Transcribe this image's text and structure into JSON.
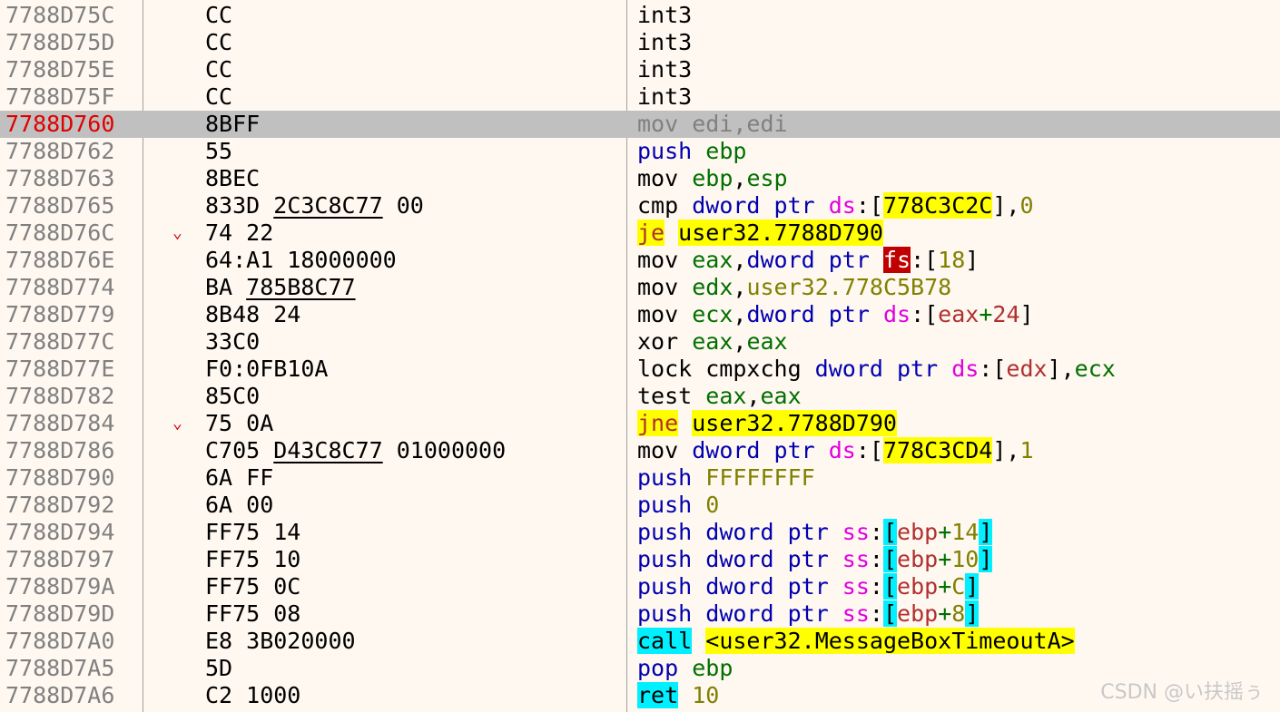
{
  "rows": [
    {
      "addr": "7788D75C",
      "arrow": "",
      "bytes": [
        {
          "t": "CC"
        }
      ],
      "dis": [
        {
          "t": "int3"
        }
      ]
    },
    {
      "addr": "7788D75D",
      "arrow": "",
      "bytes": [
        {
          "t": "CC"
        }
      ],
      "dis": [
        {
          "t": "int3"
        }
      ]
    },
    {
      "addr": "7788D75E",
      "arrow": "",
      "bytes": [
        {
          "t": "CC"
        }
      ],
      "dis": [
        {
          "t": "int3"
        }
      ]
    },
    {
      "addr": "7788D75F",
      "arrow": "",
      "bytes": [
        {
          "t": "CC"
        }
      ],
      "dis": [
        {
          "t": "int3"
        }
      ]
    },
    {
      "addr": "7788D760",
      "eip": true,
      "selected": true,
      "arrow": "",
      "bytes": [
        {
          "t": "8BFF"
        }
      ],
      "dis": [
        {
          "t": "mov edi,edi"
        }
      ]
    },
    {
      "addr": "7788D762",
      "arrow": "",
      "bytes": [
        {
          "t": "55"
        }
      ],
      "dis": [
        {
          "t": "push",
          "c": "ins"
        },
        {
          "t": " "
        },
        {
          "t": "ebp",
          "c": "reg"
        }
      ]
    },
    {
      "addr": "7788D763",
      "arrow": "",
      "bytes": [
        {
          "t": "8BEC"
        }
      ],
      "dis": [
        {
          "t": "mov "
        },
        {
          "t": "ebp",
          "c": "reg"
        },
        {
          "t": ","
        },
        {
          "t": "esp",
          "c": "reg"
        }
      ]
    },
    {
      "addr": "7788D765",
      "arrow": "",
      "bytes": [
        {
          "t": "833D "
        },
        {
          "t": "2C3C8C77",
          "u": true
        },
        {
          "t": " 00"
        }
      ],
      "dis": [
        {
          "t": "cmp "
        },
        {
          "t": "dword ptr ",
          "c": "ins"
        },
        {
          "t": "ds",
          "c": "seg"
        },
        {
          "t": ":["
        },
        {
          "t": "778C3C2C",
          "h": "y"
        },
        {
          "t": "],"
        },
        {
          "t": "0",
          "c": "num"
        }
      ]
    },
    {
      "addr": "7788D76C",
      "arrow": "⌄",
      "bytes": [
        {
          "t": "74 22"
        }
      ],
      "dis": [
        {
          "t": "je",
          "c": "mem",
          "h": "y"
        },
        {
          "t": " "
        },
        {
          "t": "user32.7788D790",
          "h": "y"
        }
      ]
    },
    {
      "addr": "7788D76E",
      "arrow": "",
      "bytes": [
        {
          "t": "64:A1 18000000"
        }
      ],
      "dis": [
        {
          "t": "mov "
        },
        {
          "t": "eax",
          "c": "reg"
        },
        {
          "t": ","
        },
        {
          "t": "dword ptr ",
          "c": "ins"
        },
        {
          "t": "fs",
          "h": "r"
        },
        {
          "t": ":["
        },
        {
          "t": "18",
          "c": "num"
        },
        {
          "t": "]"
        }
      ]
    },
    {
      "addr": "7788D774",
      "arrow": "",
      "bytes": [
        {
          "t": "BA "
        },
        {
          "t": "785B8C77",
          "u": true
        }
      ],
      "dis": [
        {
          "t": "mov "
        },
        {
          "t": "edx",
          "c": "reg"
        },
        {
          "t": ","
        },
        {
          "t": "user32.778C5B78",
          "c": "num"
        }
      ]
    },
    {
      "addr": "7788D779",
      "arrow": "",
      "bytes": [
        {
          "t": "8B48 24"
        }
      ],
      "dis": [
        {
          "t": "mov "
        },
        {
          "t": "ecx",
          "c": "reg"
        },
        {
          "t": ","
        },
        {
          "t": "dword ptr ",
          "c": "ins"
        },
        {
          "t": "ds",
          "c": "seg"
        },
        {
          "t": ":["
        },
        {
          "t": "eax",
          "c": "mem"
        },
        {
          "t": "+",
          "c": "reg"
        },
        {
          "t": "24",
          "c": "mem"
        },
        {
          "t": "]"
        }
      ]
    },
    {
      "addr": "7788D77C",
      "arrow": "",
      "bytes": [
        {
          "t": "33C0"
        }
      ],
      "dis": [
        {
          "t": "xor "
        },
        {
          "t": "eax",
          "c": "reg"
        },
        {
          "t": ","
        },
        {
          "t": "eax",
          "c": "reg"
        }
      ]
    },
    {
      "addr": "7788D77E",
      "arrow": "",
      "bytes": [
        {
          "t": "F0:0FB10A"
        }
      ],
      "dis": [
        {
          "t": "lock cmpxchg "
        },
        {
          "t": "dword ptr ",
          "c": "ins"
        },
        {
          "t": "ds",
          "c": "seg"
        },
        {
          "t": ":["
        },
        {
          "t": "edx",
          "c": "mem"
        },
        {
          "t": "],"
        },
        {
          "t": "ecx",
          "c": "reg"
        }
      ]
    },
    {
      "addr": "7788D782",
      "arrow": "",
      "bytes": [
        {
          "t": "85C0"
        }
      ],
      "dis": [
        {
          "t": "test "
        },
        {
          "t": "eax",
          "c": "reg"
        },
        {
          "t": ","
        },
        {
          "t": "eax",
          "c": "reg"
        }
      ]
    },
    {
      "addr": "7788D784",
      "arrow": "⌄",
      "bytes": [
        {
          "t": "75 0A"
        }
      ],
      "dis": [
        {
          "t": "jne",
          "c": "mem",
          "h": "y"
        },
        {
          "t": " "
        },
        {
          "t": "user32.7788D790",
          "h": "y"
        }
      ]
    },
    {
      "addr": "7788D786",
      "arrow": "",
      "bytes": [
        {
          "t": "C705 "
        },
        {
          "t": "D43C8C77",
          "u": true
        },
        {
          "t": " 01000000"
        }
      ],
      "dis": [
        {
          "t": "mov "
        },
        {
          "t": "dword ptr ",
          "c": "ins"
        },
        {
          "t": "ds",
          "c": "seg"
        },
        {
          "t": ":["
        },
        {
          "t": "778C3CD4",
          "h": "y"
        },
        {
          "t": "],"
        },
        {
          "t": "1",
          "c": "num"
        }
      ]
    },
    {
      "addr": "7788D790",
      "arrow": "",
      "bytes": [
        {
          "t": "6A FF"
        }
      ],
      "dis": [
        {
          "t": "push",
          "c": "ins"
        },
        {
          "t": " "
        },
        {
          "t": "FFFFFFFF",
          "c": "num"
        }
      ]
    },
    {
      "addr": "7788D792",
      "arrow": "",
      "bytes": [
        {
          "t": "6A 00"
        }
      ],
      "dis": [
        {
          "t": "push",
          "c": "ins"
        },
        {
          "t": " "
        },
        {
          "t": "0",
          "c": "num"
        }
      ]
    },
    {
      "addr": "7788D794",
      "arrow": "",
      "bytes": [
        {
          "t": "FF75 14"
        }
      ],
      "dis": [
        {
          "t": "push",
          "c": "ins"
        },
        {
          "t": " "
        },
        {
          "t": "dword ptr ",
          "c": "ins"
        },
        {
          "t": "ss",
          "c": "seg"
        },
        {
          "t": ":"
        },
        {
          "t": "[",
          "h": "c"
        },
        {
          "t": "ebp",
          "c": "mem"
        },
        {
          "t": "+",
          "c": "reg"
        },
        {
          "t": "14",
          "c": "num"
        },
        {
          "t": "]",
          "h": "c"
        }
      ]
    },
    {
      "addr": "7788D797",
      "arrow": "",
      "bytes": [
        {
          "t": "FF75 10"
        }
      ],
      "dis": [
        {
          "t": "push",
          "c": "ins"
        },
        {
          "t": " "
        },
        {
          "t": "dword ptr ",
          "c": "ins"
        },
        {
          "t": "ss",
          "c": "seg"
        },
        {
          "t": ":"
        },
        {
          "t": "[",
          "h": "c"
        },
        {
          "t": "ebp",
          "c": "mem"
        },
        {
          "t": "+",
          "c": "reg"
        },
        {
          "t": "10",
          "c": "num"
        },
        {
          "t": "]",
          "h": "c"
        }
      ]
    },
    {
      "addr": "7788D79A",
      "arrow": "",
      "bytes": [
        {
          "t": "FF75 0C"
        }
      ],
      "dis": [
        {
          "t": "push",
          "c": "ins"
        },
        {
          "t": " "
        },
        {
          "t": "dword ptr ",
          "c": "ins"
        },
        {
          "t": "ss",
          "c": "seg"
        },
        {
          "t": ":"
        },
        {
          "t": "[",
          "h": "c"
        },
        {
          "t": "ebp",
          "c": "mem"
        },
        {
          "t": "+",
          "c": "reg"
        },
        {
          "t": "C",
          "c": "num"
        },
        {
          "t": "]",
          "h": "c"
        }
      ]
    },
    {
      "addr": "7788D79D",
      "arrow": "",
      "bytes": [
        {
          "t": "FF75 08"
        }
      ],
      "dis": [
        {
          "t": "push",
          "c": "ins"
        },
        {
          "t": " "
        },
        {
          "t": "dword ptr ",
          "c": "ins"
        },
        {
          "t": "ss",
          "c": "seg"
        },
        {
          "t": ":"
        },
        {
          "t": "[",
          "h": "c"
        },
        {
          "t": "ebp",
          "c": "mem"
        },
        {
          "t": "+",
          "c": "reg"
        },
        {
          "t": "8",
          "c": "num"
        },
        {
          "t": "]",
          "h": "c"
        }
      ]
    },
    {
      "addr": "7788D7A0",
      "arrow": "",
      "bytes": [
        {
          "t": "E8 3B020000"
        }
      ],
      "dis": [
        {
          "t": "call",
          "h": "c"
        },
        {
          "t": " "
        },
        {
          "t": "<user32.MessageBoxTimeoutA>",
          "h": "y"
        }
      ]
    },
    {
      "addr": "7788D7A5",
      "arrow": "",
      "bytes": [
        {
          "t": "5D"
        }
      ],
      "dis": [
        {
          "t": "pop",
          "c": "ins"
        },
        {
          "t": " "
        },
        {
          "t": "ebp",
          "c": "reg"
        }
      ]
    },
    {
      "addr": "7788D7A6",
      "arrow": "",
      "bytes": [
        {
          "t": "C2 1000"
        }
      ],
      "dis": [
        {
          "t": "ret",
          "h": "c"
        },
        {
          "t": " "
        },
        {
          "t": "10",
          "c": "num"
        }
      ]
    }
  ],
  "watermark": "CSDN @い扶摇ぅ",
  "colors": {
    "background": "#fff8f0",
    "selected_row": "#c0c0c0",
    "highlight_yellow": "#ffff00",
    "highlight_cyan": "#00f0ff",
    "highlight_red": "#c00000",
    "eip_address": "#e00000"
  }
}
